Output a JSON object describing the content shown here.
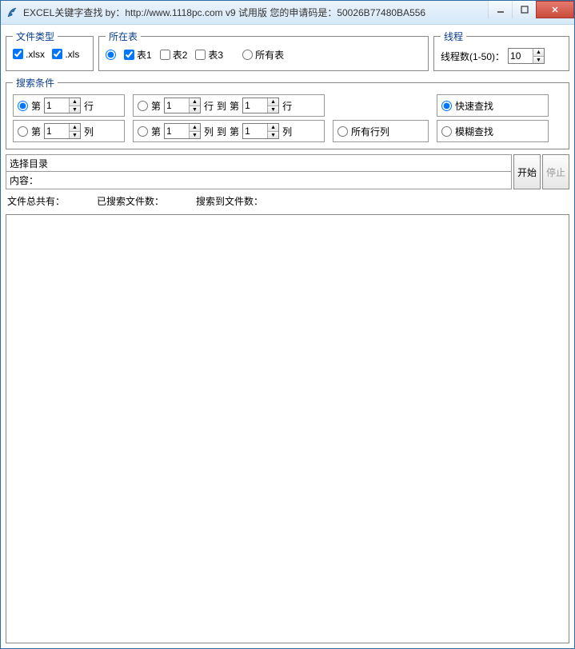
{
  "window": {
    "title": "EXCEL关键字查找  by：http://www.1118pc.com v9 试用版 您的申请码是：50026B77480BA556"
  },
  "filetype": {
    "legend": "文件类型",
    "xlsx_label": ".xlsx",
    "xls_label": ".xls",
    "xlsx_checked": true,
    "xls_checked": true
  },
  "sheet": {
    "legend": "所在表",
    "t1": "表1",
    "t2": "表2",
    "t3": "表3",
    "all": "所有表"
  },
  "thread": {
    "legend": "线程",
    "label": "线程数(1-50)：",
    "value": "10"
  },
  "search": {
    "legend": "搜索条件",
    "di": "第",
    "hang": "行",
    "lie": "列",
    "dao": "到",
    "row_val": "1",
    "col_val": "1",
    "r_from": "1",
    "r_to": "1",
    "c_from": "1",
    "c_to": "1",
    "all_rc": "所有行列",
    "fast": "快速查找",
    "fuzzy": "模糊查找"
  },
  "dir": {
    "select_label": "选择目录",
    "content_label": "内容：",
    "dir_value": "",
    "content_value": ""
  },
  "buttons": {
    "start": "开始",
    "stop": "停止"
  },
  "stats": {
    "total": "文件总共有：",
    "searched": "已搜索文件数：",
    "found": "搜索到文件数："
  }
}
